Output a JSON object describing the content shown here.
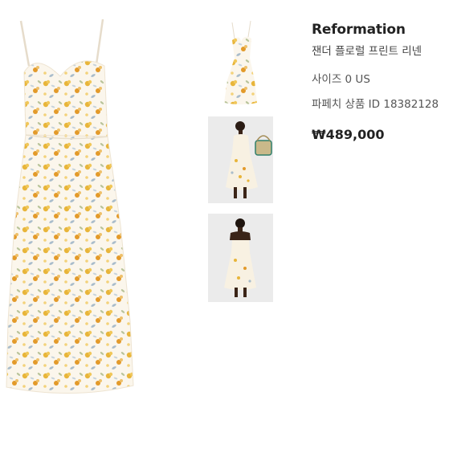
{
  "product": {
    "brand": "Reformation",
    "title": "잰더 플로럴 프린트 리넨",
    "size": "사이즈 0 US",
    "product_id": "파페치 상품 ID 18382128",
    "price": "₩489,000"
  },
  "gallery": {
    "main_image": "floral-midi-dress-front",
    "thumbnails": [
      "dress-front-small",
      "model-front-with-basket",
      "model-back"
    ]
  },
  "colors": {
    "dress_base": "#fbf6ec",
    "flower_yellow": "#e8b53a",
    "flower_orange": "#e39a2a",
    "leaf_blue": "#a9bccb",
    "leaf_green": "#b9c49a"
  }
}
